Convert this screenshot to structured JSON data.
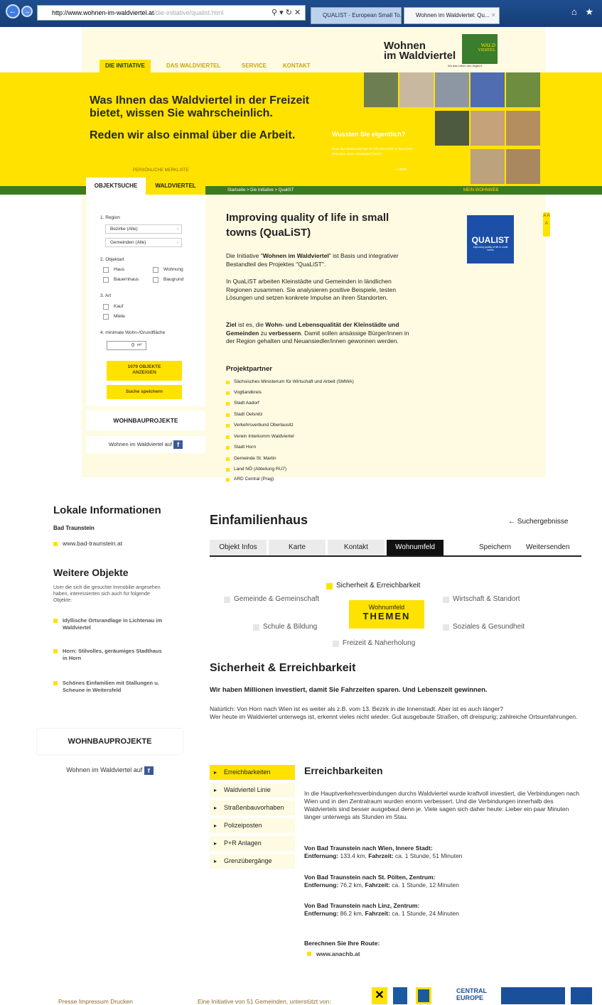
{
  "browser": {
    "back": "←",
    "forward": "→",
    "url_host": "http://www.wohnen-im-waldviertel.at",
    "url_path": "/die-initiative/qualist.html",
    "addr_icons": "⚲ ▾ ↻ ✕",
    "tab1": "QUALIST - European Small To...",
    "tab2": "Wohnen im Waldviertel: Qu...",
    "tab2_close": "✕",
    "toolbar_right": "⌂ ★"
  },
  "logo": {
    "line1": "Wohnen",
    "line2": "im Waldviertel",
    "badge_line1": "WALD",
    "badge_line2": "VIERTEL",
    "tagline": "Wo das Leben neu beginnt."
  },
  "nav": [
    "DIE INITIATIVE",
    "DAS WALDVIERTEL",
    "SERVICE",
    "KONTAKT"
  ],
  "hero": {
    "line1": "Was Ihnen das Waldviertel in der Freizeit bietet, wissen Sie wahrscheinlich.",
    "line2": "Reden wir also einmal über die Arbeit.",
    "wussten_title": "Wussten Sie eigentlich?",
    "wussten_text": "Dass das Waldviertel fast 50.000 Menschen in fast 8.500 Betrieben einen Arbeitsplatz bietet?",
    "wussten_more": "» mehr"
  },
  "merkliste": "PERSÖNLICHE MERKLISTE",
  "breadcrumb": "Startseite  >  Die Initiative  >  QualiST",
  "mein_wohnweb": "MEIN WOHNWEB",
  "search": {
    "tab1": "OBJEKTSUCHE",
    "tab2": "WALDVIERTEL",
    "region_label": "1. Region",
    "bezirke": "Bezirke (Alle)",
    "gemeinden": "Gemeinden (Alle)",
    "objektart_label": "2. Objektart",
    "haus": "Haus",
    "wohnung": "Wohnung",
    "bauernhaus": "Bauernhaus",
    "baugrund": "Baugrund",
    "art_label": "3. Art",
    "kauf": "Kauf",
    "miete": "Miete",
    "flaeche_label": "4. minimale Wohn-/Grundfläche",
    "flaeche_value": "0",
    "flaeche_unit": "m²",
    "show_btn_1": "1079 OBJEKTE",
    "show_btn_2": "ANZEIGEN",
    "save_btn": "Suche speichern"
  },
  "wohnbauprojekte": "WOHNBAUPROJEKTE",
  "wiw_auf": "Wohnen im Waldviertel auf",
  "fb": "f",
  "article": {
    "title": "Improving quality of life in small towns (QuaLiST)",
    "p1_pre": "Die Initiative \"",
    "p1_bold": "Wohnen im Waldviertel",
    "p1_post": "\" ist Basis und integrativer Bestandteil des Projektes \"QuaLiST\".",
    "p2": "In QuaLiST arbeiten Kleinstädte und Gemeinden in ländlichen Regionen zusammen. Sie analysieren positive Beispiele, testen Lösungen und setzen konkrete Impulse an ihren Standorten.",
    "p3_b1": "Ziel",
    "p3_t1": " ist es, die ",
    "p3_b2": "Wohn- und Lebensqualität der Kleinstädte und Gemeinden",
    "p3_t2": " zu ",
    "p3_b3": "verbessern",
    "p3_t3": ". Damit sollen ansässige Bürger/innen in der Region gehalten und Neuansiedler/innen gewonnen werden.",
    "partner_heading": "Projektpartner",
    "partners": [
      "Sächsisches Ministerium für Wirtschaft und Arbeit (SMWA)",
      "Vogtlandkreis",
      "Stadt Aadorf",
      "Stadt Oelsnitz",
      "Verkehrsverbund Oberlausitz",
      "Verein Interkomm Waldviertel",
      "Stadt Horn",
      "Gemeinde St. Martin",
      "Land NÖ (Abteilung RU7)",
      "ARD Central (Prag)"
    ],
    "qualist_logo": "QUALIST",
    "qualist_sub": "Improving quality of life in small towns",
    "font_sizes": "A A A"
  },
  "page2": {
    "lokale_heading": "Lokale Informationen",
    "ort": "Bad Traunstein",
    "ort_link": "www.bad-traunstein.at",
    "weitere_heading": "Weitere Objekte",
    "weitere_desc": "User die sich die gesuchte Immobilie angesehen haben, interessierten sich auch für folgende Objekte:",
    "objekte": [
      "Idyllische Ortsrandlage in Lichtenau im Waldviertel",
      "Horn: Stilvolles, geräumiges Stadthaus in Horn",
      "Schönes Einfamilien mit Stallungen u. Scheune in Weitersfeld"
    ],
    "title": "Einfamilienhaus",
    "back": "← Suchergebnisse",
    "tabs": [
      "Objekt Infos",
      "Karte",
      "Kontakt",
      "Wohnumfeld"
    ],
    "speichern": "Speichern",
    "weitersenden": "Weitersenden",
    "themen": {
      "sicherheit": "Sicherheit & Erreichbarkeit",
      "gemeinde": "Gemeinde & Gemeinschaft",
      "wirtschaft": "Wirtschaft & Standort",
      "schule": "Schule & Bildung",
      "soziales": "Soziales & Gesundheit",
      "freizeit": "Freizeit & Naherholung",
      "center1": "Wohnumfeld",
      "center2": "THEMEN"
    },
    "sicher_heading": "Sicherheit & Erreichbarkeit",
    "sicher_sub": "Wir haben Millionen investiert, damit Sie Fahrzeiten sparen. Und Lebenszeit gewinnen.",
    "sicher_p1": "Natürlich: Von Horn nach Wien ist es weiter als z.B. vom 13. Bezirk in die Innenstadt. Aber ist es auch länger?",
    "sicher_p2": "Wer heute im Waldviertel unterwegs ist, erkennt vieles nicht wieder. Gut ausgebaute Straßen, oft dreispurig; zahlreiche Ortsumfahrungen.",
    "side": [
      "Erreichbarkeiten",
      "Waldviertel Linie",
      "Straßenbauvorhaben",
      "Polizeiposten",
      "P+R Anlagen",
      "Grenzübergänge"
    ],
    "erreich_heading": "Erreichbarkeiten",
    "erreich_p": "In die Hauptverkehrsverbindungen durchs Waldviertel wurde kraftvoll investiert, die Verbindungen nach Wien und in den Zentralraum wurden enorm verbessert. Und die Verbindungen innerhalb des Waldviertels sind besser ausgebaut denn je. Viele sagen sich daher heute: Lieber ein paar Minuten länger unterwegs als Stunden im Stau.",
    "routes": [
      {
        "h": "Von Bad Traunstein nach Wien, Innere Stadt:",
        "e_lbl": "Entfernung:",
        "e": " 133.4 km, ",
        "f_lbl": "Fahrzeit:",
        "f": " ca. 1 Stunde, 51 Minuten"
      },
      {
        "h": "Von Bad Traunstein nach St. Pölten, Zentrum:",
        "e_lbl": "Entfernung:",
        "e": " 76.2 km, ",
        "f_lbl": "Fahrzeit:",
        "f": " ca. 1 Stunde, 12 Minuten"
      },
      {
        "h": "Von Bad Traunstein nach Linz, Zentrum:",
        "e_lbl": "Entfernung:",
        "e": " 86.2 km, ",
        "f_lbl": "Fahrzeit:",
        "f": " ca. 1 Stunde, 24 Minuten"
      }
    ],
    "berechnen": "Berechnen Sie Ihre Route:",
    "anachb": "www.anachb.at",
    "footer_links": "Presse   Impressum   Drucken",
    "footer_init": "Eine Initiative von 51 Gemeinden, unterstützt von:",
    "sponsor_logos": [
      "Raiffeisen",
      "eco plus",
      "NÖ",
      "CENTRAL EUROPE",
      "EUROPEAN UNION",
      "QUALIST"
    ]
  },
  "colors": {
    "brand_yellow": "#ffe200",
    "brand_green": "#3d7a1e"
  }
}
